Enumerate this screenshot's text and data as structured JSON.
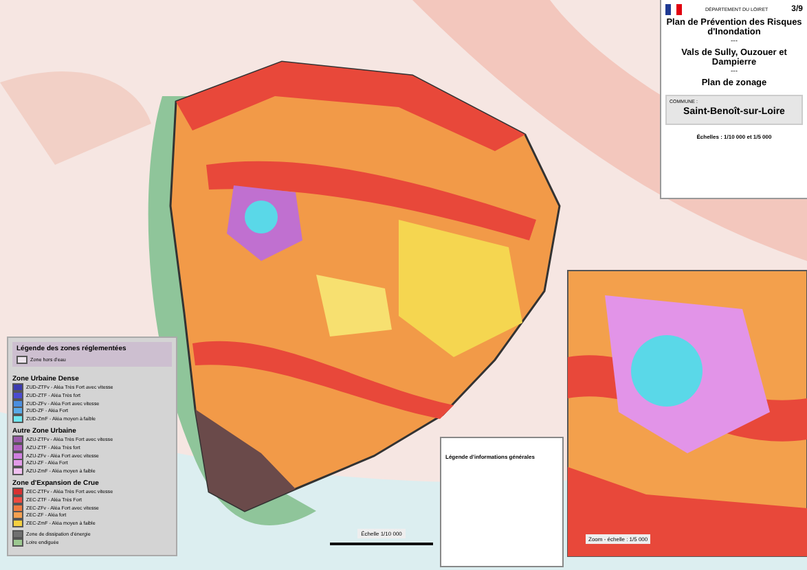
{
  "title_block": {
    "department": "DÉPARTEMENT DU LOIRET",
    "sheet": "3/9",
    "title": "Plan de Prévention des Risques d'Inondation",
    "separator_1": "---",
    "area": "Vals de Sully, Ouzouer et Dampierre",
    "separator_2": "---",
    "subtitle": "Plan de zonage",
    "commune_label": "COMMUNE :",
    "commune": "Saint-Benoît-sur-Loire",
    "scales": "Échelles : 1/10 000 et 1/5 000"
  },
  "legend": {
    "title": "Légende des zones réglementées",
    "note": {
      "label": "Zone hors d'eau",
      "color": "#ece4ec"
    },
    "items": [
      {
        "kind": "section",
        "label": "Zone Urbaine Dense"
      },
      {
        "kind": "zone",
        "label": "ZUD-ZTFv - Aléa Très Fort avec vitesse",
        "color": "#3b3bb0"
      },
      {
        "kind": "zone",
        "label": "ZUD-ZTF - Aléa Très fort",
        "color": "#4b4bd0"
      },
      {
        "kind": "zone",
        "label": "ZUD-ZFv - Aléa Fort avec vitesse",
        "color": "#4a8ee0"
      },
      {
        "kind": "zone",
        "label": "ZUD-ZF - Aléa Fort",
        "color": "#5aaae8"
      },
      {
        "kind": "zone",
        "label": "ZUD-ZmF - Aléa moyen à faible",
        "color": "#6fe6f0"
      },
      {
        "kind": "section",
        "label": "Autre Zone Urbaine"
      },
      {
        "kind": "zone",
        "label": "AZU-ZTFv - Aléa Très Fort avec vitesse",
        "color": "#9a5aaa"
      },
      {
        "kind": "zone",
        "label": "AZU-ZTF - Aléa Très fort",
        "color": "#b060c0"
      },
      {
        "kind": "zone",
        "label": "AZU-ZFv - Aléa Fort avec vitesse",
        "color": "#d080e0"
      },
      {
        "kind": "zone",
        "label": "AZU-ZF - Aléa Fort",
        "color": "#e29ae8"
      },
      {
        "kind": "zone",
        "label": "AZU-ZmF - Aléa moyen à faible",
        "color": "#f0c0f0"
      },
      {
        "kind": "section",
        "label": "Zone d'Expansion de Crue"
      },
      {
        "kind": "zone",
        "label": "ZEC-ZTFv - Aléa Très Fort avec vitesse",
        "color": "#d83030"
      },
      {
        "kind": "zone",
        "label": "ZEC-ZTF - Aléa Très Fort",
        "color": "#ee4a40"
      },
      {
        "kind": "zone",
        "label": "ZEC-ZFv - Aléa Fort avec vitesse",
        "color": "#f07a40"
      },
      {
        "kind": "zone",
        "label": "ZEC-ZF - Aléa fort",
        "color": "#f5a050"
      },
      {
        "kind": "zone",
        "label": "ZEC-ZmF - Aléa moyen à faible",
        "color": "#f5d040"
      },
      {
        "kind": "gap"
      },
      {
        "kind": "zone",
        "label": "Zone de dissipation d'énergie",
        "color": "#707070"
      },
      {
        "kind": "zone",
        "label": "Loire endiguée",
        "color": "#9cc890"
      }
    ]
  },
  "general_legend": {
    "title": "Légende d'informations générales"
  },
  "scale_bar": {
    "label": "Échelle 1/10 000"
  },
  "inset": {
    "label": "Zoom - échelle : 1/5 000"
  }
}
